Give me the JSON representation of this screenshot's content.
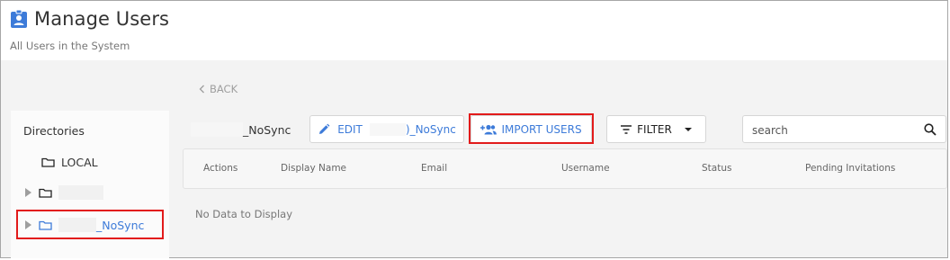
{
  "header": {
    "title": "Manage Users",
    "subtitle": "All Users in the System",
    "icon": "badge-icon",
    "accent": "#3d7bd9"
  },
  "nav": {
    "back_label": "BACK"
  },
  "directories": {
    "heading": "Directories",
    "items": [
      {
        "label": "LOCAL",
        "icon": "folder-icon",
        "expandable": false,
        "selected": false
      },
      {
        "label": "",
        "icon": "folder-icon",
        "expandable": true,
        "selected": false
      },
      {
        "label": "_NoSync",
        "icon": "folder-icon",
        "expandable": true,
        "selected": true
      }
    ]
  },
  "toolbar": {
    "directory_name": "_NoSync",
    "edit_label": "EDIT",
    "edit_directory_name": ")_NoSync",
    "import_label": "IMPORT USERS",
    "filter_label": "FILTER",
    "search_placeholder": "search"
  },
  "table": {
    "columns": [
      "Actions",
      "Display Name",
      "Email",
      "Username",
      "Status",
      "Pending Invitations"
    ],
    "rows": [],
    "empty_message": "No Data to Display"
  },
  "colors": {
    "highlight_border": "#e21b1b",
    "link_blue": "#3d7bd9",
    "background_gray": "#f3f3f3"
  }
}
